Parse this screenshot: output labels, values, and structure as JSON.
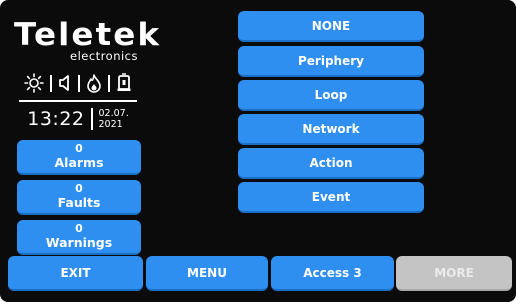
{
  "brand": {
    "name": "Teletek",
    "subtitle": "electronics"
  },
  "status_icons": [
    "sun-icon",
    "speaker-icon",
    "flame-icon",
    "bell-icon"
  ],
  "clock": {
    "time": "13:22",
    "date_line1": "02.07.",
    "date_line2": "2021"
  },
  "counters": [
    {
      "count": "0",
      "label": "Alarms"
    },
    {
      "count": "0",
      "label": "Faults"
    },
    {
      "count": "0",
      "label": "Warnings"
    }
  ],
  "options": [
    "NONE",
    "Periphery",
    "Loop",
    "Network",
    "Action",
    "Event"
  ],
  "bottom_bar": {
    "exit": "EXIT",
    "menu": "MENU",
    "access": "Access 3",
    "more": "MORE"
  },
  "colors": {
    "accent": "#2f8ff0",
    "background": "#0b0b0b",
    "disabled": "#c4c4c4"
  }
}
